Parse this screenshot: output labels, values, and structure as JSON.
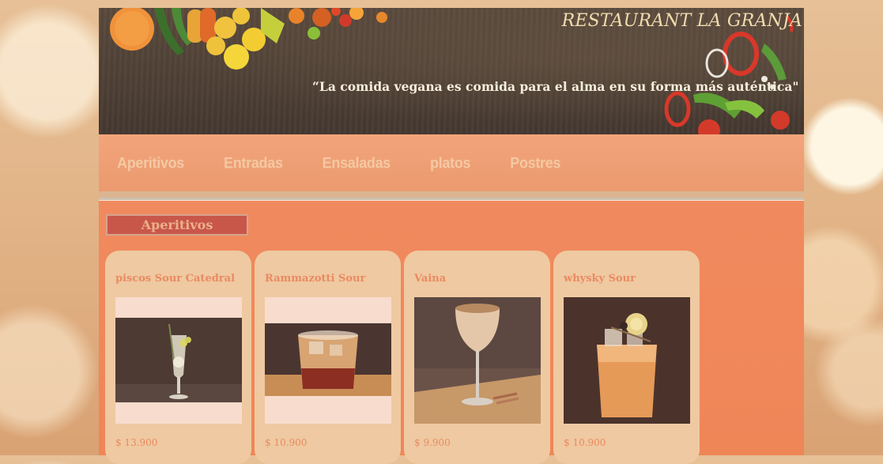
{
  "header": {
    "title": "RESTAURANT LA GRANJA",
    "quote": "“La comida vegana es comida para el alma en su forma más auténtica\""
  },
  "nav": {
    "items": [
      {
        "label": "Aperitivos"
      },
      {
        "label": "Entradas"
      },
      {
        "label": "Ensaladas"
      },
      {
        "label": "platos"
      },
      {
        "label": "Postres"
      }
    ]
  },
  "section": {
    "title": "Aperitivos"
  },
  "products": [
    {
      "name": "piscos Sour Catedral",
      "price": "$ 13.900"
    },
    {
      "name": "Rammazotti Sour",
      "price": "$ 10.900"
    },
    {
      "name": "Vaina",
      "price": "$ 9.900"
    },
    {
      "name": "whysky Sour",
      "price": "$ 10.900"
    }
  ],
  "colors": {
    "accent": "#f08a5e",
    "card": "#efc9a1",
    "banner": "#4e4035",
    "section_title_bg": "#c8574a"
  }
}
